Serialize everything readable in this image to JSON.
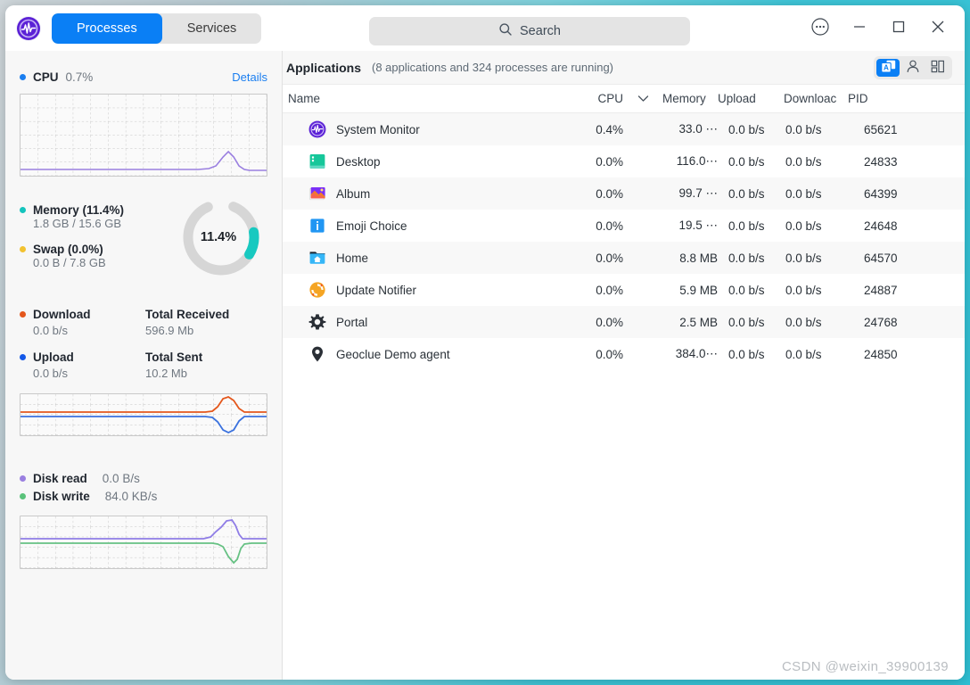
{
  "window": {
    "logo_icon": "system-monitor-logo",
    "tabs": [
      {
        "label": "Processes",
        "active": true
      },
      {
        "label": "Services",
        "active": false
      }
    ],
    "search": {
      "placeholder": "Search",
      "value": "",
      "icon": "search-icon"
    },
    "controls": [
      {
        "name": "menu-button",
        "icon": "more-circle-icon"
      },
      {
        "name": "minimize-button",
        "icon": "minimize-icon"
      },
      {
        "name": "maximize-button",
        "icon": "maximize-icon"
      },
      {
        "name": "close-button",
        "icon": "close-icon"
      }
    ]
  },
  "sidebar": {
    "cpu": {
      "dot_color": "#1a7ef0",
      "label": "CPU",
      "value": "0.7%",
      "details_label": "Details",
      "graph_line_color": "#9a7fe0"
    },
    "memory": {
      "dot_color": "#14c4bd",
      "label": "Memory (11.4%)",
      "value": "1.8 GB / 15.6 GB",
      "donut_label": "11.4%",
      "donut_percent": 11.4,
      "donut_color": "#18c9c0",
      "donut_track": "#d6d6d6"
    },
    "swap": {
      "dot_color": "#f2c230",
      "label": "Swap (0.0%)",
      "value": "0.0 B / 7.8 GB"
    },
    "network": {
      "download": {
        "dot_color": "#e4571c",
        "label": "Download",
        "value": "0.0 b/s",
        "total_label": "Total Received",
        "total_value": "596.9 Mb"
      },
      "upload": {
        "dot_color": "#1458e8",
        "label": "Upload",
        "value": "0.0 b/s",
        "total_label": "Total Sent",
        "total_value": "10.2 Mb"
      },
      "graph_down_color": "#e4571c",
      "graph_up_color": "#3b72de"
    },
    "disk": {
      "read": {
        "dot_color": "#9a7fe0",
        "label": "Disk read",
        "value": "0.0 B/s"
      },
      "write": {
        "dot_color": "#5ac27a",
        "label": "Disk write",
        "value": "84.0 KB/s"
      },
      "graph_read_color": "#8f7de6",
      "graph_write_color": "#66c183"
    }
  },
  "main": {
    "title": "Applications",
    "subtitle": "(8 applications and 324 processes are running)",
    "view_toggles": [
      {
        "name": "applications-view",
        "icon": "windows-a-icon",
        "active": true
      },
      {
        "name": "my-processes-view",
        "icon": "user-icon",
        "active": false
      },
      {
        "name": "all-processes-view",
        "icon": "tree-grid-icon",
        "active": false
      }
    ],
    "table": {
      "columns": [
        {
          "key": "name",
          "label": "Name"
        },
        {
          "key": "cpu",
          "label": "CPU",
          "sorted": true,
          "sort_icon": "chevron-down-icon"
        },
        {
          "key": "memory",
          "label": "Memory"
        },
        {
          "key": "upload",
          "label": "Upload"
        },
        {
          "key": "download",
          "label": "Downloac"
        },
        {
          "key": "pid",
          "label": "PID"
        }
      ],
      "rows": [
        {
          "icon": "system-monitor-icon",
          "name": "System Monitor",
          "cpu": "0.4%",
          "memory": "33.0 ⋯",
          "upload": "0.0 b/s",
          "download": "0.0 b/s",
          "pid": "65621"
        },
        {
          "icon": "desktop-icon",
          "name": "Desktop",
          "cpu": "0.0%",
          "memory": "116.0⋯",
          "upload": "0.0 b/s",
          "download": "0.0 b/s",
          "pid": "24833"
        },
        {
          "icon": "album-icon",
          "name": "Album",
          "cpu": "0.0%",
          "memory": "99.7 ⋯",
          "upload": "0.0 b/s",
          "download": "0.0 b/s",
          "pid": "64399"
        },
        {
          "icon": "emoji-choice-icon",
          "name": "Emoji Choice",
          "cpu": "0.0%",
          "memory": "19.5 ⋯",
          "upload": "0.0 b/s",
          "download": "0.0 b/s",
          "pid": "24648"
        },
        {
          "icon": "home-folder-icon",
          "name": "Home",
          "cpu": "0.0%",
          "memory": "8.8 MB",
          "upload": "0.0 b/s",
          "download": "0.0 b/s",
          "pid": "64570"
        },
        {
          "icon": "update-notifier-icon",
          "name": "Update Notifier",
          "cpu": "0.0%",
          "memory": "5.9 MB",
          "upload": "0.0 b/s",
          "download": "0.0 b/s",
          "pid": "24887"
        },
        {
          "icon": "gear-icon",
          "name": "Portal",
          "cpu": "0.0%",
          "memory": "2.5 MB",
          "upload": "0.0 b/s",
          "download": "0.0 b/s",
          "pid": "24768"
        },
        {
          "icon": "location-pin-icon",
          "name": "Geoclue Demo agent",
          "cpu": "0.0%",
          "memory": "384.0⋯",
          "upload": "0.0 b/s",
          "download": "0.0 b/s",
          "pid": "24850"
        }
      ]
    }
  },
  "watermark": "CSDN @weixin_39900139"
}
